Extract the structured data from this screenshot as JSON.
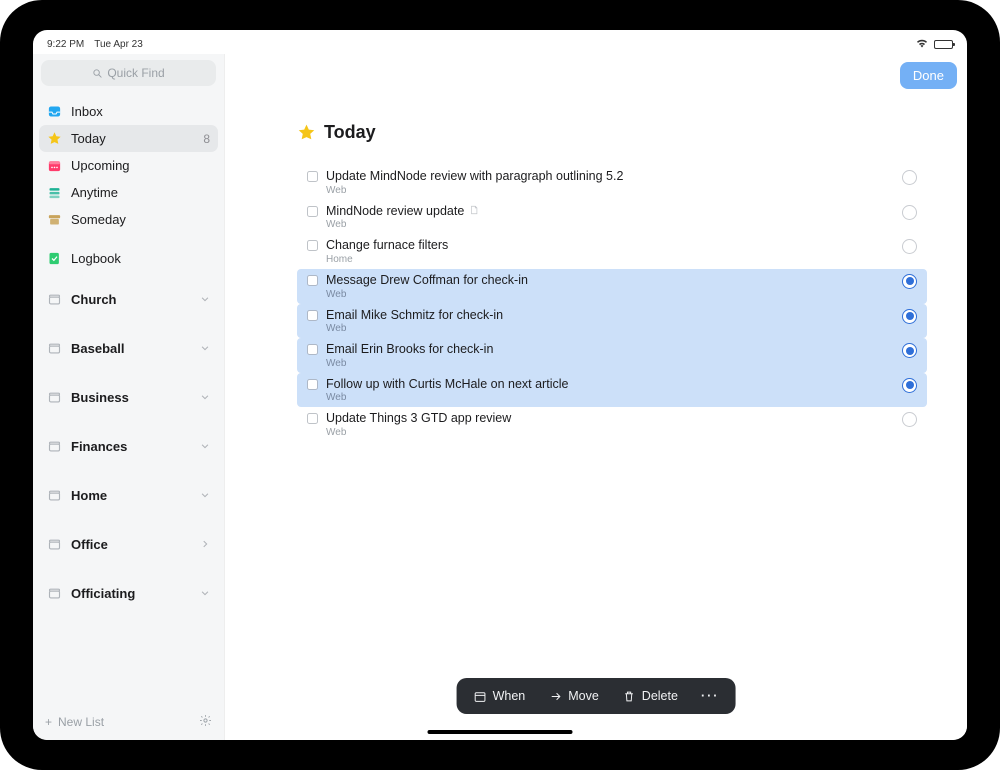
{
  "status": {
    "time": "9:22 PM",
    "date": "Tue Apr 23"
  },
  "search": {
    "placeholder": "Quick Find"
  },
  "header": {
    "done_label": "Done"
  },
  "sidebar": {
    "nav": [
      {
        "id": "inbox",
        "label": "Inbox",
        "icon": "inbox",
        "color": "#22a7f0"
      },
      {
        "id": "today",
        "label": "Today",
        "icon": "star",
        "color": "#f5c518",
        "badge": "8",
        "active": true
      },
      {
        "id": "upcoming",
        "label": "Upcoming",
        "icon": "calendar",
        "color": "#ff3b6b"
      },
      {
        "id": "anytime",
        "label": "Anytime",
        "icon": "stack",
        "color": "#1eb295"
      },
      {
        "id": "someday",
        "label": "Someday",
        "icon": "archive",
        "color": "#c9a45c"
      },
      {
        "id": "logbook",
        "label": "Logbook",
        "icon": "logbook",
        "color": "#2ecc71"
      }
    ],
    "areas": [
      {
        "label": "Church",
        "chevron": "down"
      },
      {
        "label": "Baseball",
        "chevron": "down"
      },
      {
        "label": "Business",
        "chevron": "down"
      },
      {
        "label": "Finances",
        "chevron": "down"
      },
      {
        "label": "Home",
        "chevron": "down"
      },
      {
        "label": "Office",
        "chevron": "right"
      },
      {
        "label": "Officiating",
        "chevron": "down"
      }
    ],
    "footer": {
      "new_list": "New List"
    }
  },
  "page": {
    "title": "Today",
    "tasks": [
      {
        "title": "Update MindNode review with paragraph outlining 5.2",
        "project": "Web",
        "selected": false,
        "has_note": false
      },
      {
        "title": "MindNode review update",
        "project": "Web",
        "selected": false,
        "has_note": true
      },
      {
        "title": "Change furnace filters",
        "project": "Home",
        "selected": false,
        "has_note": false
      },
      {
        "title": "Message Drew Coffman for check-in",
        "project": "Web",
        "selected": true,
        "has_note": false
      },
      {
        "title": "Email Mike Schmitz for check-in",
        "project": "Web",
        "selected": true,
        "has_note": false
      },
      {
        "title": "Email Erin Brooks for check-in",
        "project": "Web",
        "selected": true,
        "has_note": false
      },
      {
        "title": "Follow up with Curtis McHale on next article",
        "project": "Web",
        "selected": true,
        "has_note": false
      },
      {
        "title": "Update Things 3 GTD app review",
        "project": "Web",
        "selected": false,
        "has_note": false
      }
    ]
  },
  "action_bar": {
    "when": "When",
    "move": "Move",
    "delete": "Delete"
  }
}
